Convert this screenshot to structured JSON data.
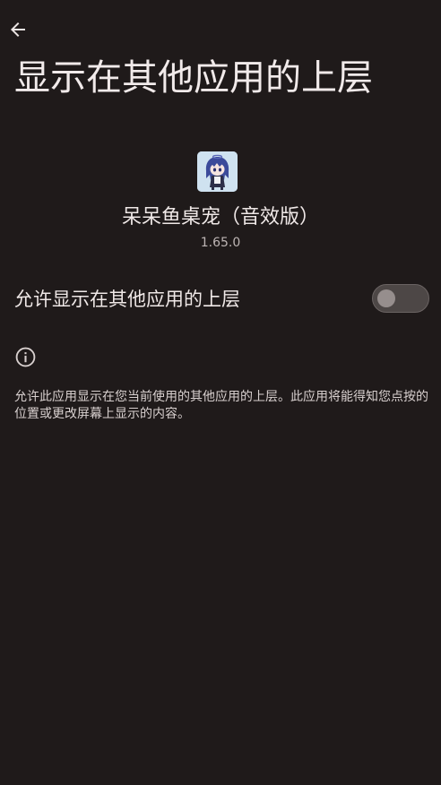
{
  "header": {
    "back_icon": "arrow-left-icon",
    "title": "显示在其他应用的上层"
  },
  "app": {
    "icon": "app-character-icon",
    "name": "呆呆鱼桌宠（音效版）",
    "version": "1.65.0"
  },
  "permission": {
    "label": "允许显示在其他应用的上层",
    "enabled": false
  },
  "info": {
    "icon": "info-icon",
    "description": "允许此应用显示在您当前使用的其他应用的上层。此应用将能得知您点按的位置或更改屏幕上显示的内容。"
  },
  "colors": {
    "background": "#1f1a1a",
    "switch_track_off": "#4d4746",
    "switch_thumb_off": "#968e8d"
  }
}
